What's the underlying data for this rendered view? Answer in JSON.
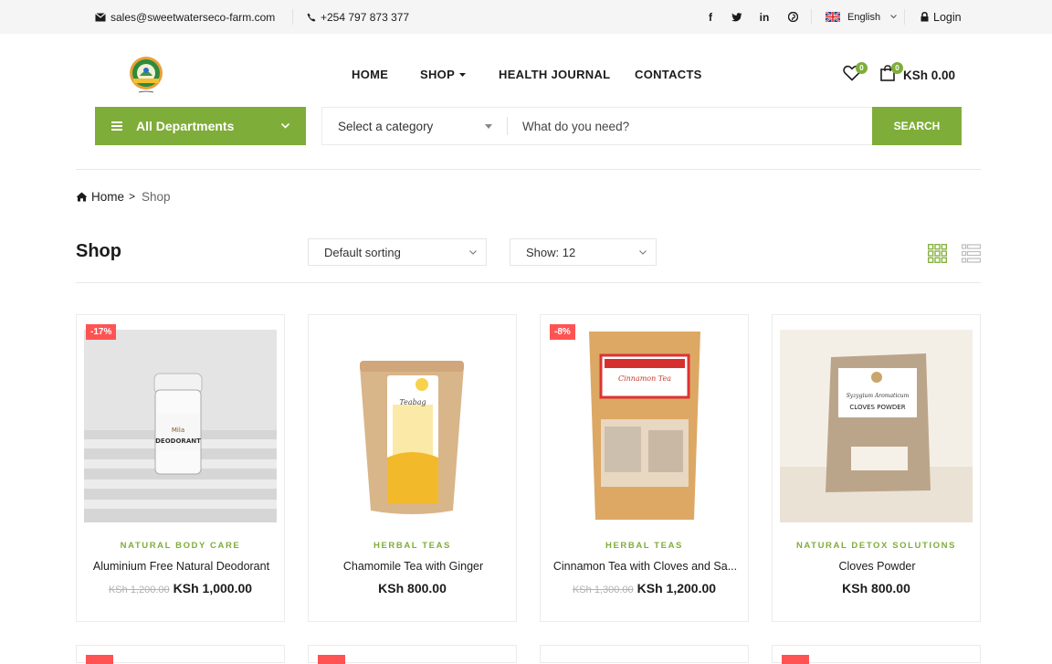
{
  "topbar": {
    "email": "sales@sweetwaterseco-farm.com",
    "phone": "+254 797 873 377",
    "language": "English",
    "login": "Login",
    "social": [
      "f",
      "t",
      "in",
      "p"
    ]
  },
  "header": {
    "nav": [
      "HOME",
      "SHOP",
      "HEALTH JOURNAL",
      "CONTACTS"
    ],
    "wishlist_count": "0",
    "cart_count": "0",
    "cart_total": "KSh 0.00"
  },
  "search": {
    "departments": "All Departments",
    "category": "Select a category",
    "placeholder": "What do you need?",
    "button": "SEARCH"
  },
  "breadcrumb": {
    "home": "Home",
    "sep": ">",
    "current": "Shop"
  },
  "shop": {
    "title": "Shop",
    "sorting": "Default sorting",
    "show": "Show: 12"
  },
  "products": [
    {
      "discount": "-17%",
      "category": "NATURAL BODY CARE",
      "name": "Aluminium Free Natural Deodorant",
      "old_price": "KSh 1,200.00",
      "price": "KSh 1,000.00"
    },
    {
      "discount": "",
      "category": "HERBAL TEAS",
      "name": "Chamomile Tea with Ginger",
      "old_price": "",
      "price": "KSh 800.00"
    },
    {
      "discount": "-8%",
      "category": "HERBAL TEAS",
      "name": "Cinnamon Tea with Cloves and Sa...",
      "old_price": "KSh 1,300.00",
      "price": "KSh 1,200.00"
    },
    {
      "discount": "",
      "category": "NATURAL DETOX SOLUTIONS",
      "name": "Cloves Powder",
      "old_price": "",
      "price": "KSh 800.00"
    }
  ],
  "colors": {
    "accent": "#7fad39",
    "discount": "#ff5353"
  }
}
